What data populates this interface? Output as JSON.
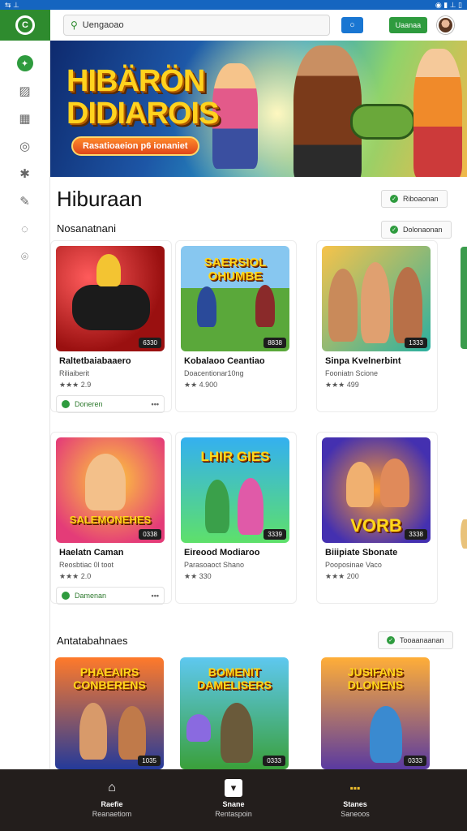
{
  "statusbar": {
    "left": "⇆ ⊥",
    "right": "◉ ▮ ⊥ ▯"
  },
  "sidebar": {
    "logo_letter": "C",
    "icons": [
      "badge-icon",
      "image-icon",
      "grid-icon",
      "chat-icon",
      "star-icon",
      "edit-icon",
      "message-icon",
      "location-icon"
    ]
  },
  "topbar": {
    "search_text": "Uengaoao",
    "green_button": "Uaanaa"
  },
  "hero": {
    "title_line1": "HIBÄRÖN",
    "title_line2": "DIDIAROIS",
    "tag": "Rasatioaeion p6 ionaniet"
  },
  "page": {
    "heading": "Hiburaan",
    "heading_pill": "Riboaonan",
    "section1_title": "Nosanatnani",
    "section1_pill": "Dolonaonan",
    "section3_title": "Antatabahnaes",
    "section3_pill": "Tooaanaanan"
  },
  "row1": [
    {
      "title": "Raltetbaiabaaero",
      "meta": "Riliaiberit",
      "rating": "★★★ 2.9",
      "badge": "6330",
      "action": "Doneren"
    },
    {
      "title": "Kobalaoo Ceantiao",
      "meta": "Doacentionar10ng",
      "rating": "★★ 4.900",
      "badge": "8838"
    },
    {
      "title": "Sinpa Kvelnerbint",
      "meta": "Fooniatn Scione",
      "rating": "★★★ 499",
      "badge": "1333"
    }
  ],
  "row2": [
    {
      "title": "Haelatn Caman",
      "meta": "Reosbtiac 0l toot",
      "rating": "★★★ 2.0",
      "badge": "0338",
      "action": "Damenan"
    },
    {
      "title": "Eireood Modiaroo",
      "meta": "Parasoaoct Shano",
      "rating": "★★ 330",
      "badge": "3339"
    },
    {
      "title": "Biiipiate Sbonate",
      "meta": "Pooposinae Vaco",
      "rating": "★★★ 200",
      "badge": "3338"
    }
  ],
  "row3": [
    {
      "badge": "1035"
    },
    {
      "badge": "0333"
    },
    {
      "badge": "0333"
    }
  ],
  "game_art": {
    "a_text": "",
    "b_text": "SAERSIOL OHUMBE",
    "c_text": "",
    "d_text": "SALEMONEHES",
    "e_text": "LHIR GIES",
    "f_text": "VORB",
    "g_text": "PHAEAIRS CONBERENS",
    "h_text": "BOMENIT DAMELISERS",
    "i_text": "JUSIFANS DLONENS"
  },
  "bottomnav": [
    {
      "l1": "Raefie",
      "l2": "Reanaetiom"
    },
    {
      "l1": "Snane",
      "l2": "Rentaspoin"
    },
    {
      "l1": "Stanes",
      "l2": "Saneoos"
    }
  ]
}
